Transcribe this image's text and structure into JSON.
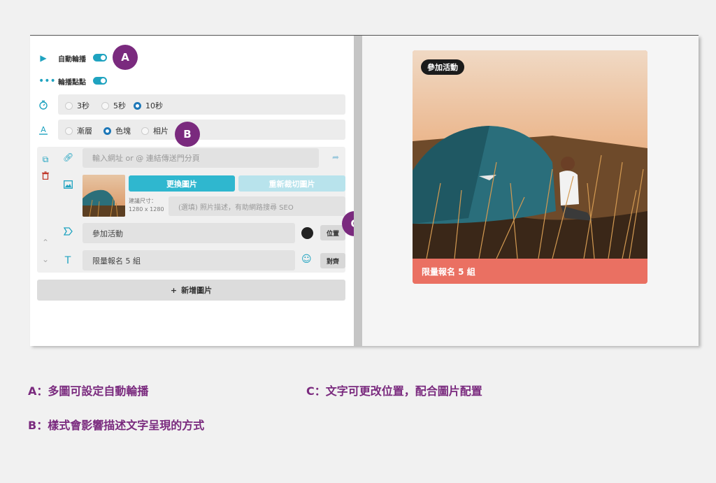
{
  "settings": {
    "autoplay_label": "自動輪播",
    "dots_label": "輪播點點",
    "duration_options": [
      "3秒",
      "5秒",
      "10秒"
    ],
    "duration_selected": "10秒",
    "style_options": [
      "漸層",
      "色塊",
      "相片"
    ],
    "style_selected": "色塊"
  },
  "item": {
    "link_placeholder": "輸入網址 or @ 連結傳送門分頁",
    "replace_image_label": "更換圖片",
    "recrop_image_label": "重新裁切圖片",
    "size_hint_label": "建議尺寸：",
    "size_hint_value": "1280 x 1280",
    "alt_placeholder": "(選填) 照片描述，有助網路搜尋 SEO",
    "tag_value": "參加活動",
    "position_button": "位置",
    "text_value": "限量報名 5 組",
    "align_button": "對齊"
  },
  "add_image_label": "新增圖片",
  "markers": {
    "a": "A",
    "b": "B",
    "c": "C"
  },
  "preview": {
    "badge": "參加活動",
    "footer_text": "限量報名 5 組"
  },
  "captions": {
    "a": "A：多圖可設定自動輪播",
    "b": "B：樣式會影響描述文字呈現的方式",
    "c": "C：文字可更改位置，配合圖片配置"
  },
  "colors": {
    "accent": "#1fa3c0",
    "marker": "#7a2a7e",
    "footer": "#ea7062"
  },
  "icons": [
    "play-icon",
    "dots-icon",
    "timer-icon",
    "text-style-icon",
    "copy-icon",
    "trash-icon",
    "link-icon",
    "image-icon",
    "tag-icon",
    "text-icon",
    "share-icon",
    "emoji-icon",
    "chevron-up-icon",
    "chevron-down-icon",
    "plus-icon"
  ]
}
